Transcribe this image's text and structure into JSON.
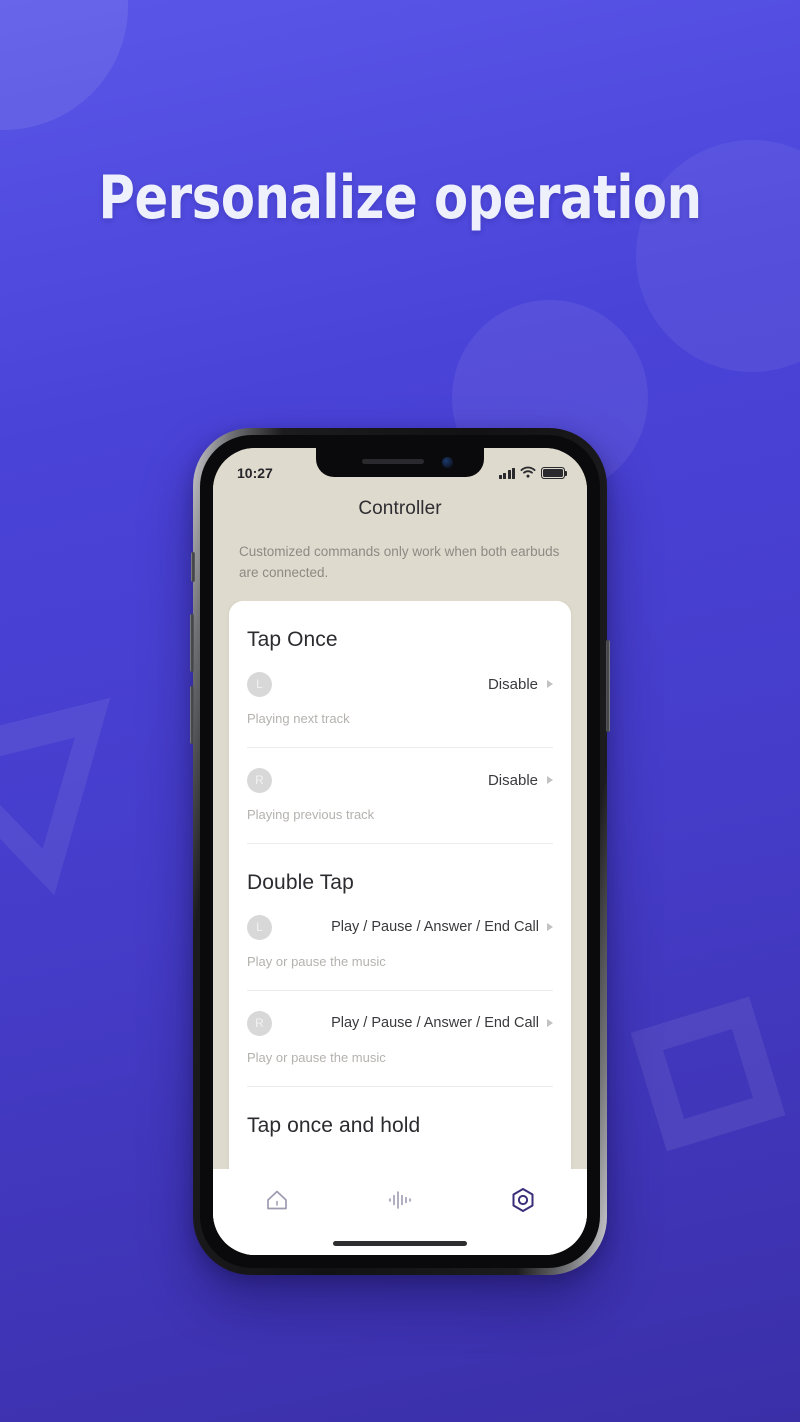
{
  "headline": "Personalize operation",
  "theme": {
    "bg_gradient_from": "#5a57e8",
    "bg_gradient_to": "#3b2fa8",
    "headline_color": "#eef0fb",
    "app_bg": "#dedace",
    "card_bg": "#ffffff",
    "accent_active": "#3a2d7a",
    "tab_inactive": "#9e9bb0"
  },
  "status_bar": {
    "time": "10:27",
    "signal_icon": "cellular-bars-icon",
    "wifi_icon": "wifi-icon",
    "battery_icon": "battery-full-icon"
  },
  "app": {
    "nav_title": "Controller",
    "hint": "Customized commands only work when both earbuds are connected.",
    "sections": [
      {
        "title": "Tap Once",
        "rows": [
          {
            "side": "L",
            "value": "Disable",
            "subtitle": "Playing next track",
            "chevron": "chevron-right-icon"
          },
          {
            "side": "R",
            "value": "Disable",
            "subtitle": "Playing previous track",
            "chevron": "chevron-right-icon"
          }
        ]
      },
      {
        "title": "Double Tap",
        "rows": [
          {
            "side": "L",
            "value": "Play / Pause / Answer / End Call",
            "subtitle": "Play or pause the music",
            "chevron": "chevron-right-icon"
          },
          {
            "side": "R",
            "value": "Play / Pause / Answer / End Call",
            "subtitle": "Play or pause the music",
            "chevron": "chevron-right-icon"
          }
        ]
      },
      {
        "title": "Tap once and hold",
        "rows": []
      }
    ],
    "tabs": [
      {
        "name": "home",
        "icon": "home-icon",
        "active": false
      },
      {
        "name": "audio",
        "icon": "waveform-icon",
        "active": false
      },
      {
        "name": "settings",
        "icon": "hex-settings-icon",
        "active": true
      }
    ]
  }
}
